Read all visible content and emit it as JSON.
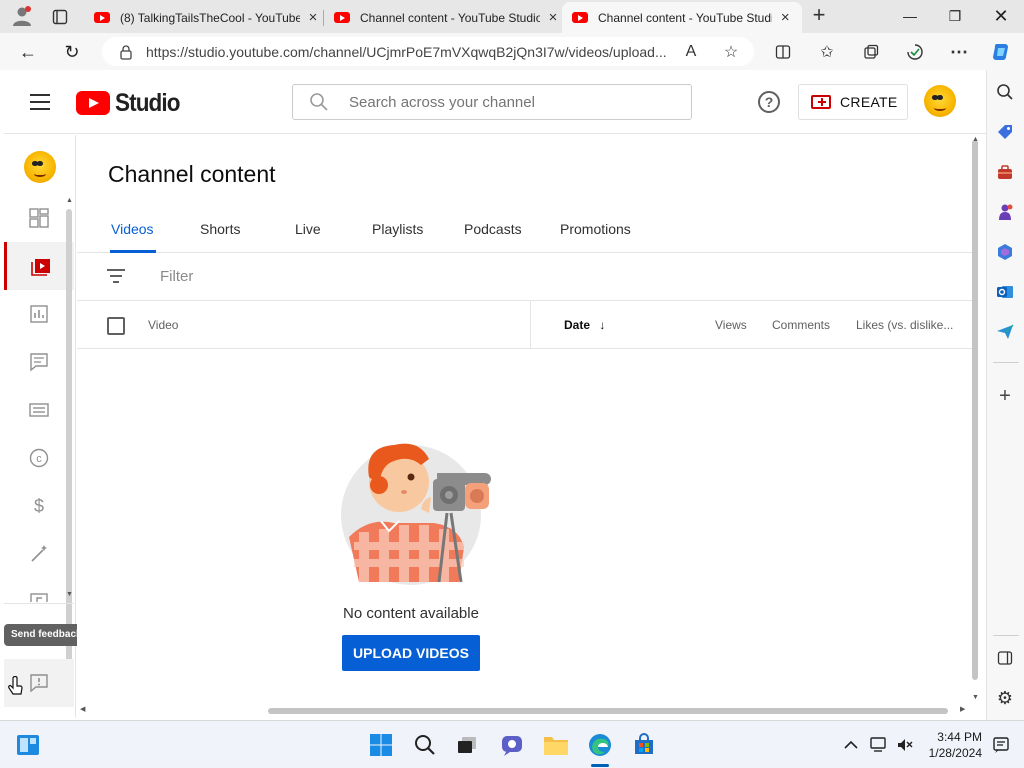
{
  "browser": {
    "tabs": [
      {
        "title": "(8) TalkingTailsTheCool - YouTube",
        "active": false
      },
      {
        "title": "Channel content - YouTube Studio",
        "active": false
      },
      {
        "title": "Channel content - YouTube Studio",
        "active": true
      }
    ],
    "url": "https://studio.youtube.com/channel/UCjmrPoE7mVXqwqB2jQn3I7w/videos/upload..."
  },
  "header": {
    "logo_text": "Studio",
    "search_placeholder": "Search across your channel",
    "help_label": "?",
    "create_label": "CREATE"
  },
  "leftnav": {
    "items": [
      {
        "icon": "dashboard-icon"
      },
      {
        "icon": "content-icon",
        "active": true
      },
      {
        "icon": "analytics-icon"
      },
      {
        "icon": "comments-icon"
      },
      {
        "icon": "subtitles-icon"
      },
      {
        "icon": "copyright-icon"
      },
      {
        "icon": "earn-icon"
      },
      {
        "icon": "customization-icon"
      },
      {
        "icon": "audio-library-icon"
      }
    ],
    "tooltip": "Send feedback"
  },
  "main": {
    "title": "Channel content",
    "tabs": [
      "Videos",
      "Shorts",
      "Live",
      "Playlists",
      "Podcasts",
      "Promotions"
    ],
    "active_tab": "Videos",
    "filter_placeholder": "Filter",
    "columns": {
      "video": "Video",
      "date": "Date",
      "views": "Views",
      "comments": "Comments",
      "likes": "Likes (vs. dislike..."
    },
    "empty_text": "No content available",
    "upload_label": "UPLOAD VIDEOS"
  },
  "taskbar": {
    "time": "3:44 PM",
    "date": "1/28/2024"
  },
  "colors": {
    "accent_blue": "#065fd4",
    "youtube_red": "#ff0000",
    "active_nav_red": "#cc0000"
  }
}
